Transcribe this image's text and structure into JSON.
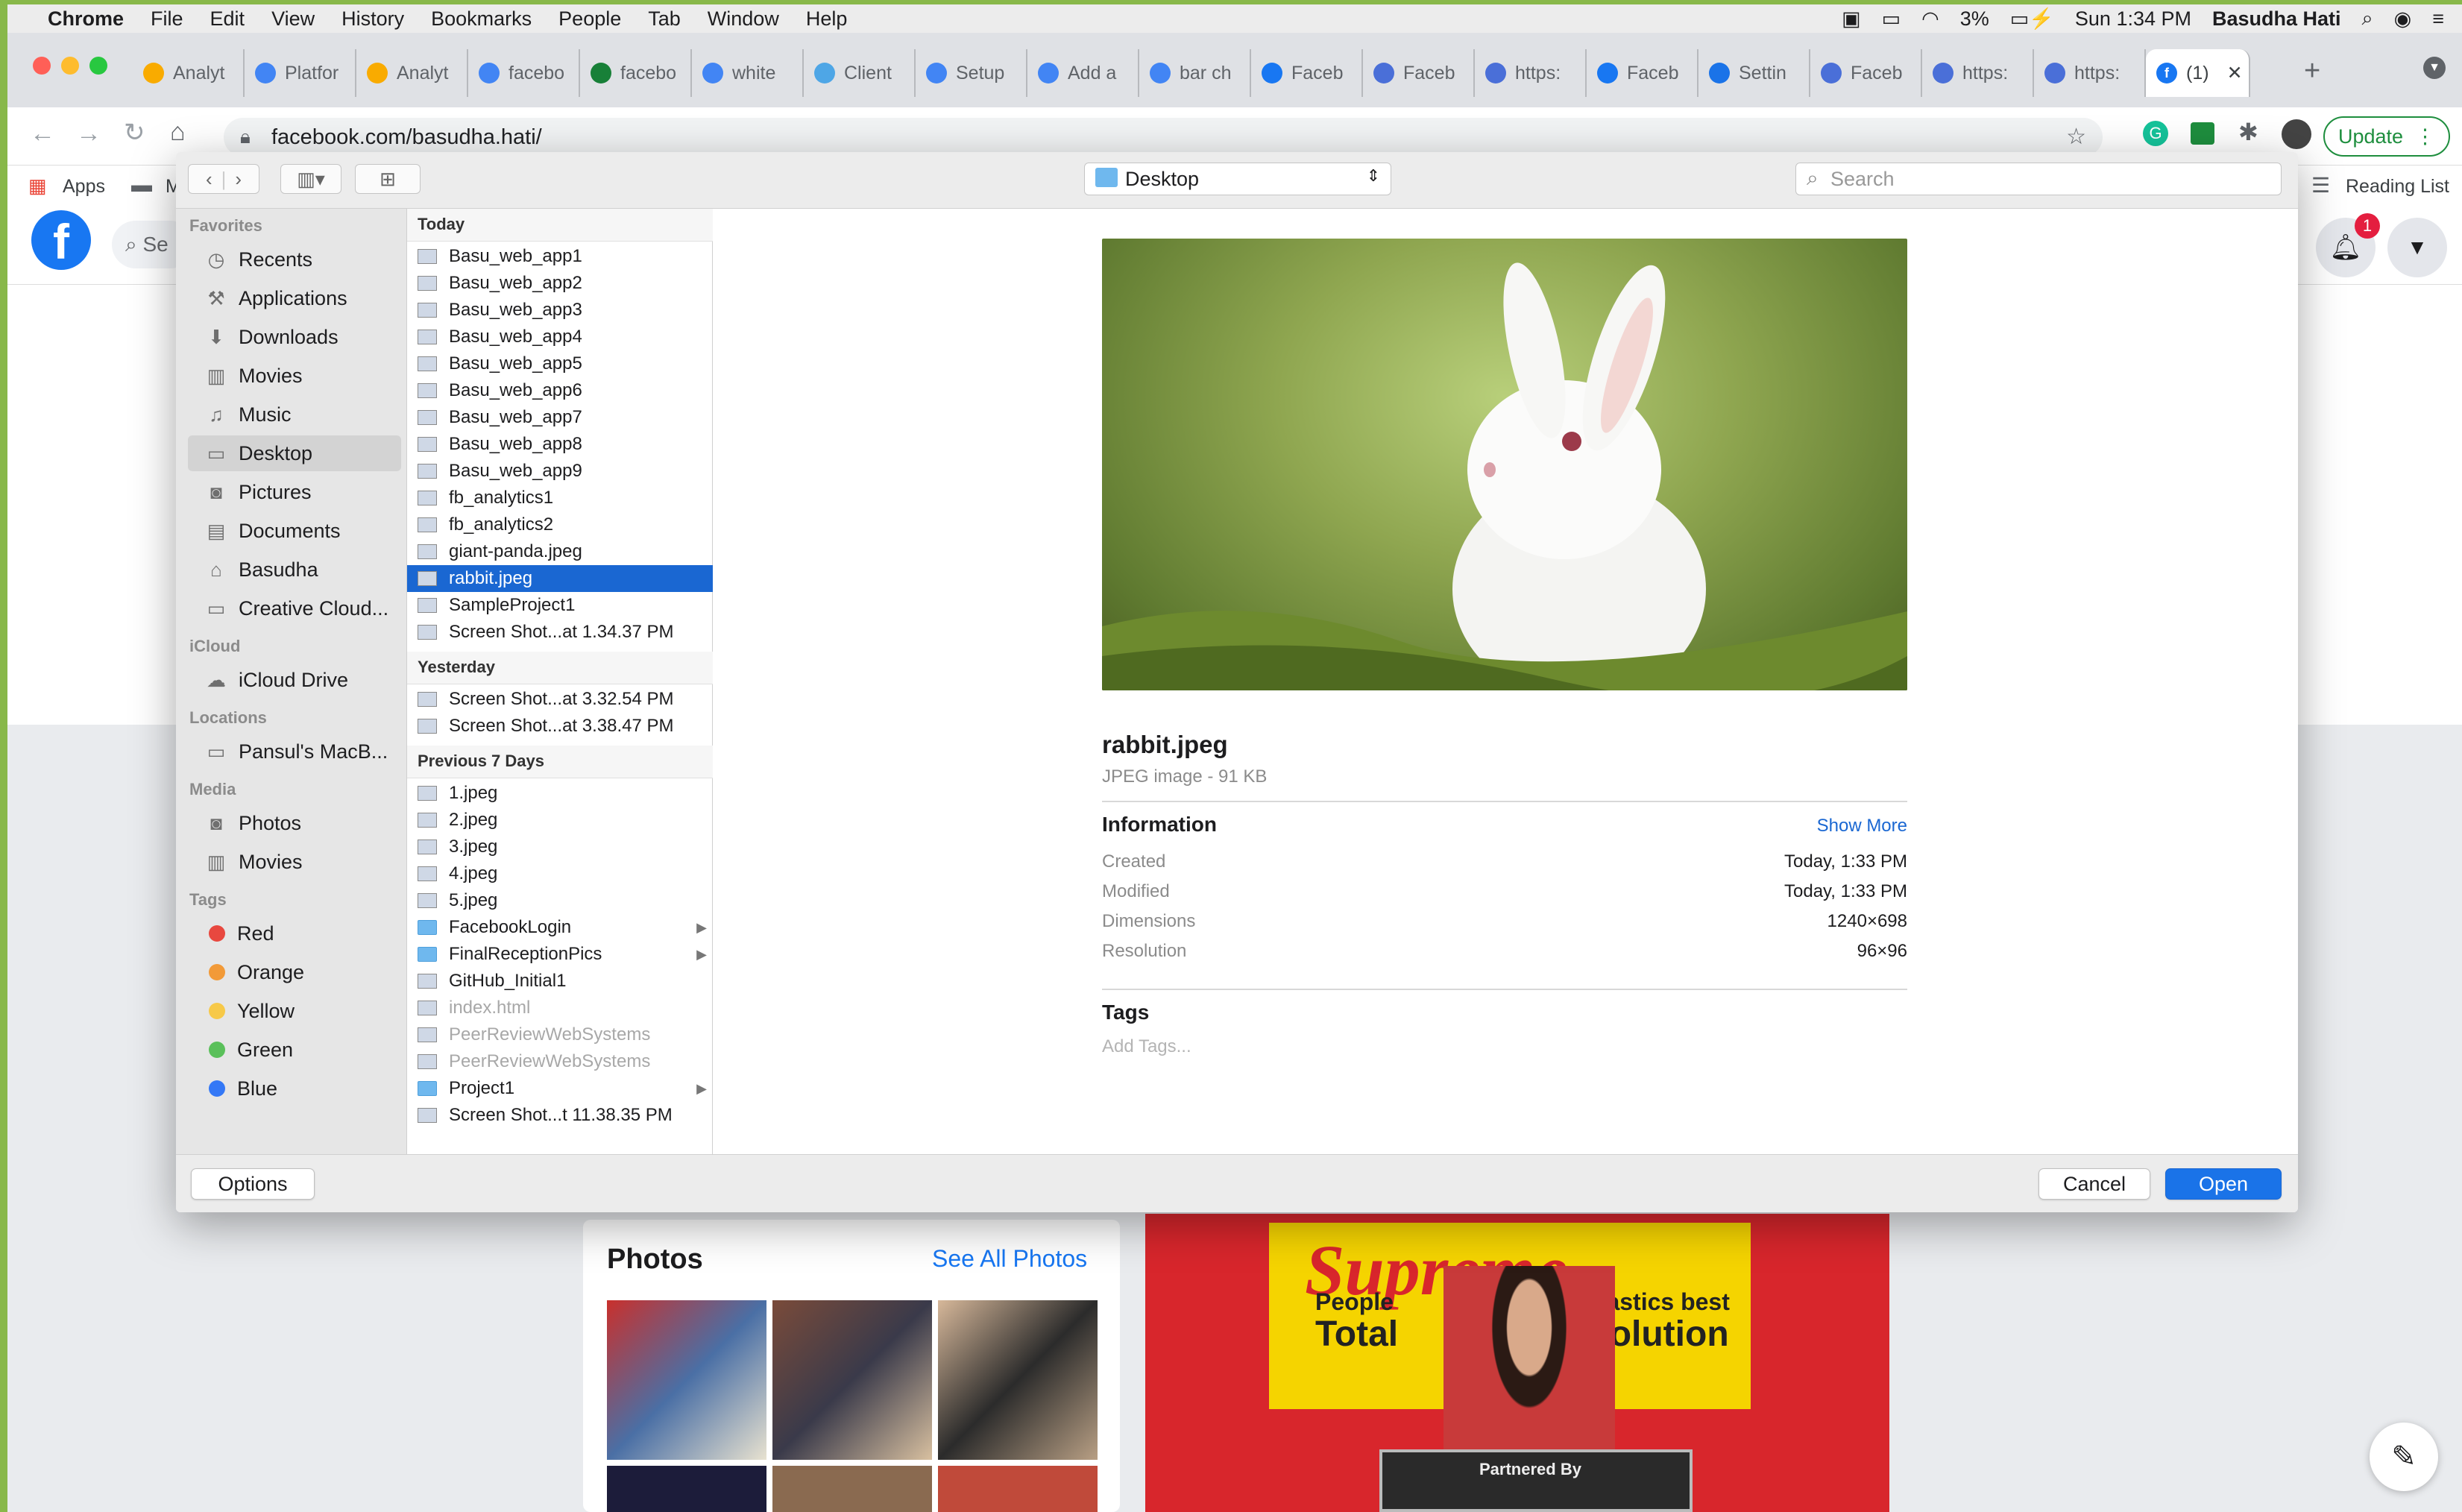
{
  "menubar": {
    "app": "Chrome",
    "items": [
      "File",
      "Edit",
      "View",
      "History",
      "Bookmarks",
      "People",
      "Tab",
      "Window",
      "Help"
    ],
    "battery": "3%",
    "clock": "Sun 1:34 PM",
    "user": "Basudha Hati"
  },
  "tabs": [
    {
      "label": "Analyt",
      "color": "#f9ab00"
    },
    {
      "label": "Platfor",
      "color": "#4285f4"
    },
    {
      "label": "Analyt",
      "color": "#f9ab00"
    },
    {
      "label": "facebo",
      "color": "#4285f4"
    },
    {
      "label": "facebo",
      "color": "#188038"
    },
    {
      "label": "white",
      "color": "#4285f4"
    },
    {
      "label": "Client",
      "color": "#4ea6e6"
    },
    {
      "label": "Setup",
      "color": "#4285f4"
    },
    {
      "label": "Add a",
      "color": "#4285f4"
    },
    {
      "label": "bar ch",
      "color": "#4285f4"
    },
    {
      "label": "Faceb",
      "color": "#1877f2"
    },
    {
      "label": "Faceb",
      "color": "#4a6fd8"
    },
    {
      "label": "https:",
      "color": "#4a6fd8"
    },
    {
      "label": "Faceb",
      "color": "#1877f2"
    },
    {
      "label": "Settin",
      "color": "#1a73e8"
    },
    {
      "label": "Faceb",
      "color": "#4a6fd8"
    },
    {
      "label": "https:",
      "color": "#4a6fd8"
    },
    {
      "label": "https:",
      "color": "#4a6fd8"
    }
  ],
  "active_tab": {
    "label": "(1)",
    "close": "✕"
  },
  "toolbar": {
    "url": "facebook.com/basudha.hati/",
    "update_label": "Update"
  },
  "bookmarks": {
    "apps": "Apps",
    "folder": "M",
    "reading_list": "Reading List"
  },
  "facebook": {
    "search_placeholder": "Se",
    "notification_count": "1",
    "photos_title": "Photos",
    "see_all": "See All Photos",
    "cover_text_1": "Supreme",
    "cover_text_2": "People",
    "cover_text_3": "plastics best",
    "cover_text_4": "Total",
    "cover_text_5": "solution",
    "cover_text_6": "Partnered By"
  },
  "dialog": {
    "location": "Desktop",
    "search_placeholder": "Search",
    "sidebar": {
      "favorites_header": "Favorites",
      "favorites": [
        {
          "label": "Recents",
          "icon": "clock-icon"
        },
        {
          "label": "Applications",
          "icon": "applications-icon"
        },
        {
          "label": "Downloads",
          "icon": "downloads-icon"
        },
        {
          "label": "Movies",
          "icon": "film-icon"
        },
        {
          "label": "Music",
          "icon": "music-icon"
        },
        {
          "label": "Desktop",
          "icon": "desktop-icon"
        },
        {
          "label": "Pictures",
          "icon": "camera-icon"
        },
        {
          "label": "Documents",
          "icon": "document-icon"
        },
        {
          "label": "Basudha",
          "icon": "home-icon"
        },
        {
          "label": "Creative Cloud...",
          "icon": "folder-icon"
        }
      ],
      "icloud_header": "iCloud",
      "icloud": [
        {
          "label": "iCloud Drive",
          "icon": "cloud-icon"
        }
      ],
      "locations_header": "Locations",
      "locations": [
        {
          "label": "Pansul's MacB...",
          "icon": "laptop-icon"
        }
      ],
      "media_header": "Media",
      "media": [
        {
          "label": "Photos",
          "icon": "camera-icon"
        },
        {
          "label": "Movies",
          "icon": "film-icon"
        }
      ],
      "tags_header": "Tags",
      "tags": [
        {
          "label": "Red",
          "color": "#e8483f"
        },
        {
          "label": "Orange",
          "color": "#f29a38"
        },
        {
          "label": "Yellow",
          "color": "#f7c948"
        },
        {
          "label": "Green",
          "color": "#5ac05a"
        },
        {
          "label": "Blue",
          "color": "#3478f6"
        }
      ]
    },
    "files": {
      "today_header": "Today",
      "today": [
        "Basu_web_app1",
        "Basu_web_app2",
        "Basu_web_app3",
        "Basu_web_app4",
        "Basu_web_app5",
        "Basu_web_app6",
        "Basu_web_app7",
        "Basu_web_app8",
        "Basu_web_app9",
        "fb_analytics1",
        "fb_analytics2",
        "giant-panda.jpeg",
        "rabbit.jpeg",
        "SampleProject1",
        "Screen Shot...at 1.34.37 PM"
      ],
      "yesterday_header": "Yesterday",
      "yesterday": [
        "Screen Shot...at 3.32.54 PM",
        "Screen Shot...at 3.38.47 PM"
      ],
      "previous_header": "Previous 7 Days",
      "previous": [
        "1.jpeg",
        "2.jpeg",
        "3.jpeg",
        "4.jpeg",
        "5.jpeg",
        "FacebookLogin",
        "FinalReceptionPics",
        "GitHub_Initial1",
        "index.html",
        "PeerReviewWebSystems",
        "PeerReviewWebSystems",
        "Project1",
        "Screen Shot...t 11.38.35 PM"
      ]
    },
    "preview": {
      "filename": "rabbit.jpeg",
      "kind": "JPEG image - 91 KB",
      "info_header": "Information",
      "show_more": "Show More",
      "rows": [
        {
          "label": "Created",
          "value": "Today, 1:33 PM"
        },
        {
          "label": "Modified",
          "value": "Today, 1:33 PM"
        },
        {
          "label": "Dimensions",
          "value": "1240×698"
        },
        {
          "label": "Resolution",
          "value": "96×96"
        }
      ],
      "tags_header": "Tags",
      "tags_placeholder": "Add Tags..."
    },
    "footer": {
      "options": "Options",
      "cancel": "Cancel",
      "open": "Open"
    }
  }
}
